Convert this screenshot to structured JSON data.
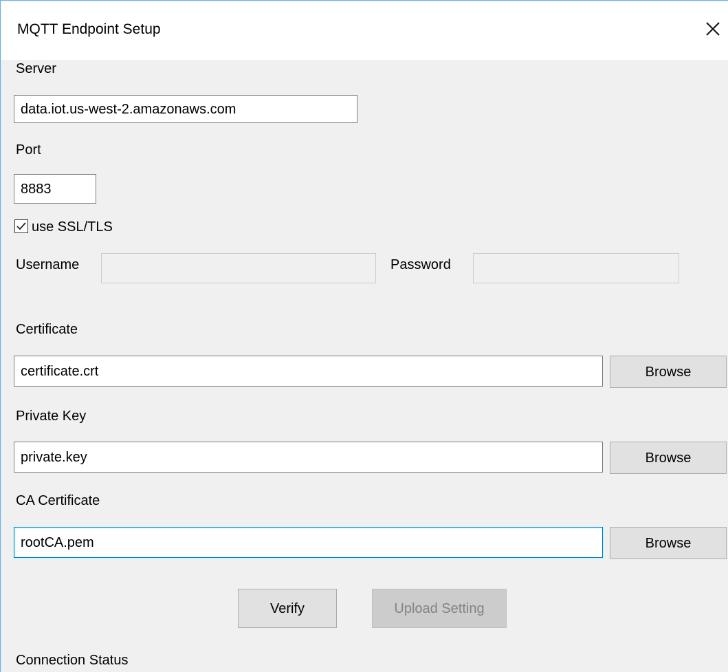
{
  "window": {
    "title": "MQTT Endpoint Setup"
  },
  "server": {
    "label": "Server",
    "value": "data.iot.us-west-2.amazonaws.com"
  },
  "port": {
    "label": "Port",
    "value": "8883"
  },
  "ssl": {
    "label": "use SSL/TLS",
    "checked": true
  },
  "username": {
    "label": "Username",
    "value": ""
  },
  "password": {
    "label": "Password",
    "value": ""
  },
  "certificate": {
    "label": "Certificate",
    "value": "certificate.crt",
    "browse_label": "Browse"
  },
  "private_key": {
    "label": "Private Key",
    "value": "private.key",
    "browse_label": "Browse"
  },
  "ca_certificate": {
    "label": "CA Certificate",
    "value": "rootCA.pem",
    "browse_label": "Browse"
  },
  "actions": {
    "verify_label": "Verify",
    "upload_label": "Upload Setting"
  },
  "status": {
    "label": "Connection Status"
  },
  "icons": {
    "close": "close-icon",
    "check": "checkmark-icon"
  },
  "colors": {
    "focus_border": "#0078d7",
    "window_border": "#7aa7d9"
  }
}
